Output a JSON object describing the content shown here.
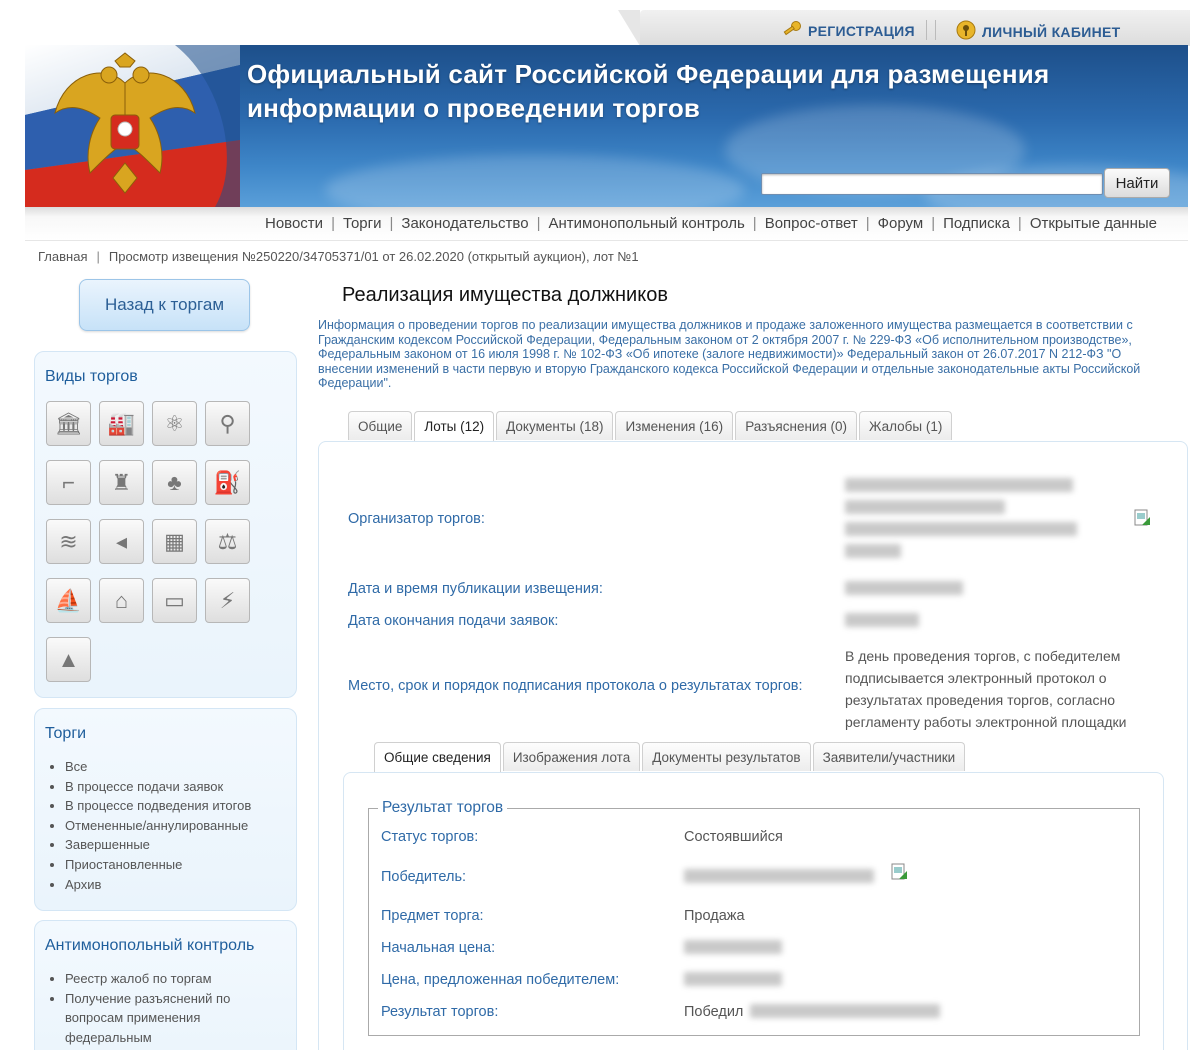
{
  "top_links": {
    "registration": "РЕГИСТРАЦИЯ",
    "cabinet": "ЛИЧНЫЙ КАБИНЕТ"
  },
  "header": {
    "title_line1": "Официальный сайт Российской Федерации для размещения",
    "title_line2": "информации о проведении торгов",
    "search_value": "",
    "search_button": "Найти"
  },
  "nav": [
    "Новости",
    "Торги",
    "Законодательство",
    "Антимонопольный контроль",
    "Вопрос-ответ",
    "Форум",
    "Подписка",
    "Открытые данные"
  ],
  "breadcrumb": {
    "home": "Главная",
    "current": "Просмотр извещения №250220/34705371/01 от 26.02.2020 (открытый аукцион), лот №1"
  },
  "sidebar": {
    "back_button": "Назад к торгам",
    "types_title": "Виды торгов",
    "type_icons": [
      "bank-icon",
      "factory-icon",
      "atom-icon",
      "theodolite-icon",
      "crane-icon",
      "hunter-icon",
      "forest-icon",
      "oil-pump-icon",
      "water-icon",
      "fish-icon",
      "building-icon",
      "scales-icon",
      "boat-icon",
      "house-icon",
      "billboard-icon",
      "power-line-icon",
      "antenna-icon"
    ],
    "torgi_title": "Торги",
    "torgi_items": [
      "Все",
      "В процессе подачи заявок",
      "В процессе подведения итогов",
      "Отмененные/аннулированные",
      "Завершенные",
      "Приостановленные",
      "Архив"
    ],
    "antimonopoly_title": "Антимонопольный контроль",
    "antimonopoly_items": [
      "Реестр жалоб по торгам",
      "Получение разъяснений по вопросам применения федеральным"
    ]
  },
  "main": {
    "title": "Реализация имущества должников",
    "intro": "Информация о проведении торгов по реализации имущества должников и продаже заложенного имущества размещается в соответствии с Гражданским кодексом Российской Федерации, Федеральным законом от 2 октября 2007 г. № 229-ФЗ «Об исполнительном производстве», Федеральным законом от 16 июля 1998 г. № 102-ФЗ «Об ипотеке (залоге недвижимости)» Федеральный закон от 26.07.2017 N 212-ФЗ \"О внесении изменений в части первую и вторую Гражданского кодекса Российской Федерации и отдельные законодательные акты Российской Федерации\".",
    "tabs": [
      "Общие",
      "Лоты (12)",
      "Документы (18)",
      "Изменения (16)",
      "Разъяснения (0)",
      "Жалобы (1)"
    ],
    "active_tab": "Лоты (12)",
    "fields": {
      "organizer_label": "Организатор торгов:",
      "publication_label": "Дата и время публикации извещения:",
      "deadline_label": "Дата окончания подачи заявок:",
      "protocol_label": "Место, срок и порядок подписания протокола о результатах торгов:",
      "protocol_value_lines": [
        "В день проведения торгов, с победителем",
        "подписывается электронный протокол о",
        "результатах проведения торгов, согласно",
        "регламенту работы электронной площадки"
      ]
    },
    "lot_tabs": [
      "Общие сведения",
      "Изображения лота",
      "Документы результатов",
      "Заявители/участники"
    ],
    "active_lot_tab": "Общие сведения",
    "result": {
      "legend": "Результат торгов",
      "status_label": "Статус торгов:",
      "status_value": "Состоявшийся",
      "winner_label": "Победитель:",
      "subject_label": "Предмет торга:",
      "subject_value": "Продажа",
      "start_price_label": "Начальная цена:",
      "winner_price_label": "Цена, предложенная победителем:",
      "result_label": "Результат торгов:",
      "result_value_prefix": "Победил"
    }
  }
}
